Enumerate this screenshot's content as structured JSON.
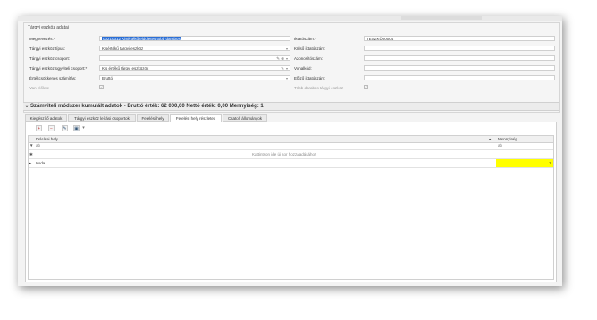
{
  "frame_title": "Tárgyi eszköz adatai",
  "left_fields": [
    {
      "label": "Megnevezés:*",
      "value": "00210312 Kisértékű eldöletes több darabos",
      "selected": true
    },
    {
      "label": "Tárgyi eszköz típus:",
      "value": "Kisértékű tárgyi eszköz"
    },
    {
      "label": "Tárgyi eszköz csoport:",
      "value": ""
    },
    {
      "label": "Tárgyi eszköz ügyviteli csoport:*",
      "value": "Kis értékű tárgyi eszközök"
    },
    {
      "label": "Értékcsökkenés számítás:",
      "value": "Bruttó"
    }
  ],
  "left_checkbox": {
    "label": "Van előlete",
    "checked": true
  },
  "right_fields": [
    {
      "label": "Iktatószám:*",
      "value": "TESZKÜ00004"
    },
    {
      "label": "Külső iktatószám:",
      "value": ""
    },
    {
      "label": "Azonosítószám:",
      "value": ""
    },
    {
      "label": "Vonalkód:",
      "value": ""
    },
    {
      "label": "Előző iktatószám:",
      "value": ""
    }
  ],
  "right_checkbox": {
    "label": "Több darabos tárgyi eszköz",
    "checked": true
  },
  "summary": "Számviteli módszer kumulált adatok - Bruttó érték: 62 000,00 Nettó érték: 0,00 Mennyiség: 1",
  "tabs": [
    "Kiegészítő adatok",
    "Tárgyi eszköz leírási csoportok",
    "Felelési hely",
    "Felelési hely részletek",
    "Csatolt állományok"
  ],
  "active_tab": 3,
  "grid": {
    "columns": [
      "Felelési hely",
      "Mennyiség"
    ],
    "filter_placeholder": "ab",
    "new_row_hint": "Kattintson ide új sor hozzáadásához",
    "rows": [
      {
        "hely": "Iroda",
        "mennyiseg": "1"
      }
    ]
  }
}
